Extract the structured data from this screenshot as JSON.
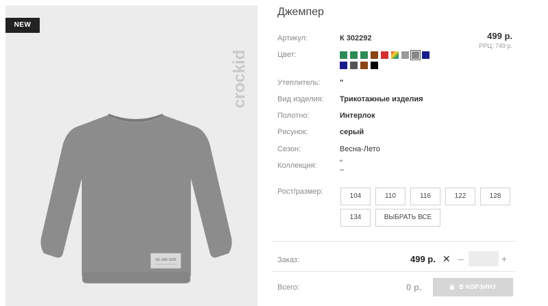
{
  "badge": {
    "new": "NEW"
  },
  "brand": {
    "name": "crockid"
  },
  "product": {
    "title": "Джемпер",
    "price": "499 р.",
    "rrp": "РРЦ: 749 р.",
    "image_label": "DE JAN 2020"
  },
  "labels": {
    "article": "Артикул:",
    "color": "Цвет:",
    "insulation": "Утеплитель:",
    "item_type": "Вид изделия:",
    "fabric": "Полотно:",
    "pattern": "Рисунок:",
    "season": "Сезон:",
    "collection": "Коллекция:",
    "size": "Рост/размер:",
    "order": "Заказ:",
    "total": "Всего:"
  },
  "values": {
    "article": "К 302292",
    "insulation": "\"",
    "item_type": "Трикотажные изделия",
    "fabric": "Интерлок",
    "pattern": "серый",
    "season": "Весна-Лето",
    "collection": "\"\n–"
  },
  "colors": [
    {
      "hex": "#2e8b57"
    },
    {
      "hex": "#2e8b57"
    },
    {
      "hex": "#2e8b57"
    },
    {
      "hex": "#8b4513"
    },
    {
      "hex": "#d32f2f"
    },
    {
      "hex": "#f4a742",
      "multicolor": true
    },
    {
      "hex": "#9a9a9a"
    },
    {
      "hex": "#888888",
      "selected": true
    },
    {
      "hex": "#1a1a8c"
    },
    {
      "hex": "#1a1a8c"
    },
    {
      "hex": "#555555"
    },
    {
      "hex": "#8b4513"
    },
    {
      "hex": "#000000"
    }
  ],
  "sizes": [
    "104",
    "110",
    "116",
    "122",
    "128",
    "134"
  ],
  "select_all": "ВЫБРАТЬ ВСЕ",
  "order": {
    "price": "499 р.",
    "times": "✕",
    "minus": "–",
    "plus": "+",
    "quantity": ""
  },
  "total": {
    "value": "0 р.",
    "cart_label": "В КОРЗИНУ"
  }
}
